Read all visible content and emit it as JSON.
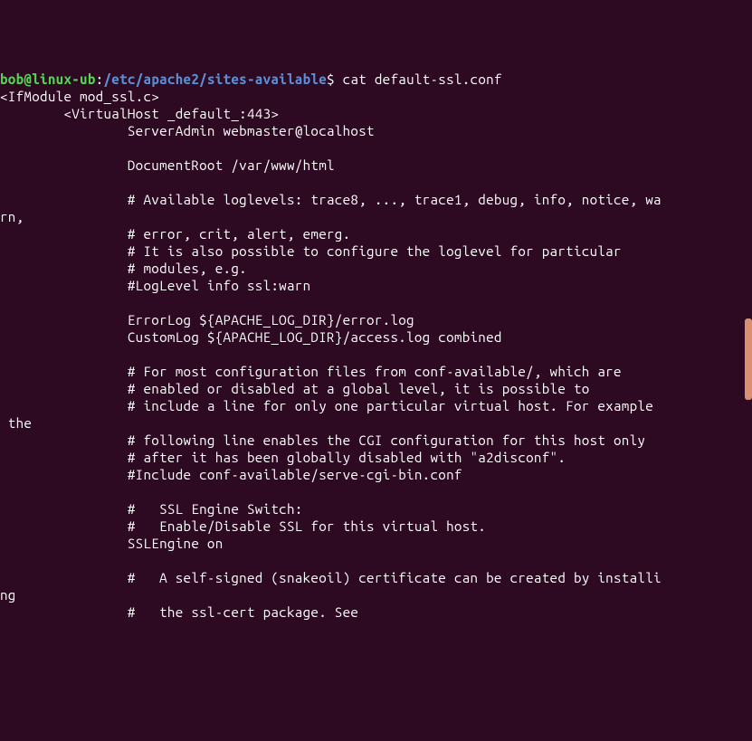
{
  "prompt": {
    "user_host": "bob@linux-ub",
    "separator": ":",
    "path": "/etc/apache2/sites-available",
    "dollar": "$",
    "command": " cat default-ssl.conf"
  },
  "output": {
    "line01": "<IfModule mod_ssl.c>",
    "line02": "        <VirtualHost _default_:443>",
    "line03": "                ServerAdmin webmaster@localhost",
    "line04": "",
    "line05": "                DocumentRoot /var/www/html",
    "line06": "",
    "line07": "                # Available loglevels: trace8, ..., trace1, debug, info, notice, wa",
    "line08": "rn,",
    "line09": "                # error, crit, alert, emerg.",
    "line10": "                # It is also possible to configure the loglevel for particular",
    "line11": "                # modules, e.g.",
    "line12": "                #LogLevel info ssl:warn",
    "line13": "",
    "line14": "                ErrorLog ${APACHE_LOG_DIR}/error.log",
    "line15": "                CustomLog ${APACHE_LOG_DIR}/access.log combined",
    "line16": "",
    "line17": "                # For most configuration files from conf-available/, which are",
    "line18": "                # enabled or disabled at a global level, it is possible to",
    "line19": "                # include a line for only one particular virtual host. For example",
    "line20": " the",
    "line21": "                # following line enables the CGI configuration for this host only",
    "line22": "                # after it has been globally disabled with \"a2disconf\".",
    "line23": "                #Include conf-available/serve-cgi-bin.conf",
    "line24": "",
    "line25": "                #   SSL Engine Switch:",
    "line26": "                #   Enable/Disable SSL for this virtual host.",
    "line27": "                SSLEngine on",
    "line28": "",
    "line29": "                #   A self-signed (snakeoil) certificate can be created by installi",
    "line30": "ng",
    "line31": "                #   the ssl-cert package. See"
  }
}
